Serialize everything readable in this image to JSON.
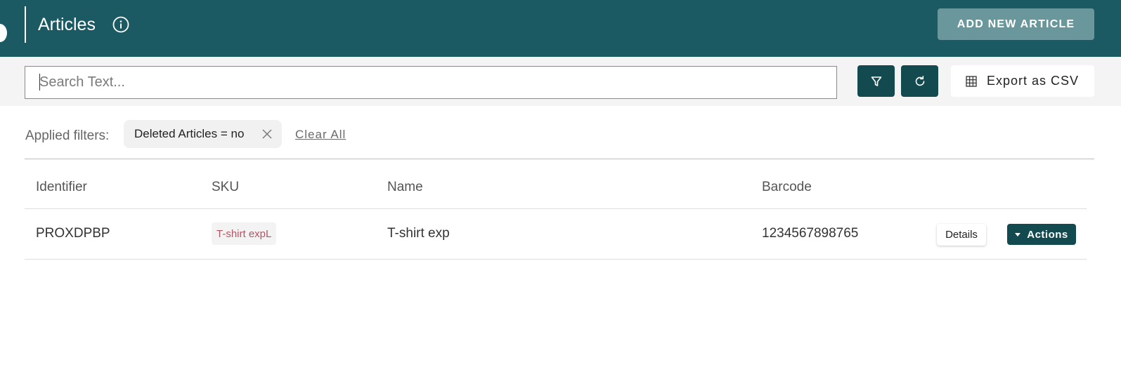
{
  "header": {
    "title": "Articles",
    "info_icon": "info-circle-icon",
    "add_button_label": "ADD NEW ARTICLE"
  },
  "toolbar": {
    "search_value": "",
    "search_placeholder": "Search Text...",
    "filter_icon": "filter-icon",
    "refresh_icon": "refresh-icon",
    "export_icon": "table-grid-icon",
    "export_label": "Export as CSV"
  },
  "filters": {
    "label": "Applied filters:",
    "chips": [
      {
        "label": "Deleted Articles = no",
        "remove_icon": "close-icon"
      }
    ],
    "clear_all_label": "Clear All"
  },
  "table": {
    "columns": [
      "Identifier",
      "SKU",
      "Name",
      "Barcode"
    ],
    "rows": [
      {
        "identifier": "PROXDPBP",
        "sku": "T-shirt expL",
        "name": "T-shirt exp",
        "barcode": "1234567898765",
        "details_label": "Details",
        "actions_label": "Actions"
      }
    ]
  },
  "colors": {
    "header_bg": "#1c5a63",
    "primary_button": "#134a50",
    "add_button_bg": "#6a979c",
    "sku_text": "#b05565"
  }
}
